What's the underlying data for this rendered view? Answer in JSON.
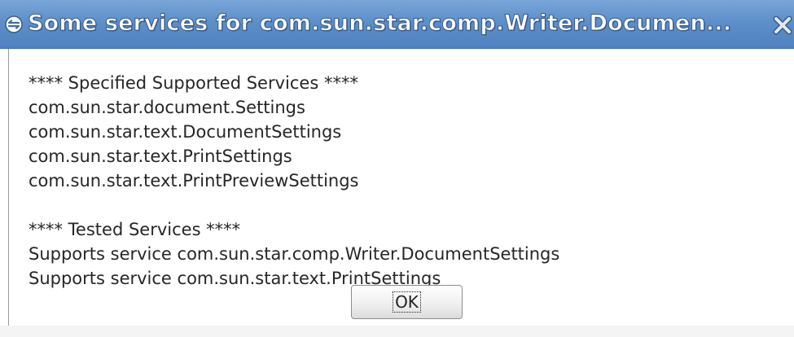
{
  "window": {
    "title": "Some services for com.sun.star.comp.Writer.Documen..."
  },
  "icons": {
    "app": "app-menu-icon",
    "close": "close-icon"
  },
  "colors": {
    "titlebar": "#5d8fc9",
    "title_text": "#ffffff",
    "body_bg": "#ffffff",
    "text": "#262626"
  },
  "dialog": {
    "lines": [
      "**** Specified Supported Services ****",
      "com.sun.star.document.Settings",
      "com.sun.star.text.DocumentSettings",
      "com.sun.star.text.PrintSettings",
      "com.sun.star.text.PrintPreviewSettings",
      "",
      "**** Tested Services ****",
      "Supports service com.sun.star.comp.Writer.DocumentSettings",
      "Supports service com.sun.star.text.PrintSettings"
    ],
    "ok_label": "OK"
  }
}
